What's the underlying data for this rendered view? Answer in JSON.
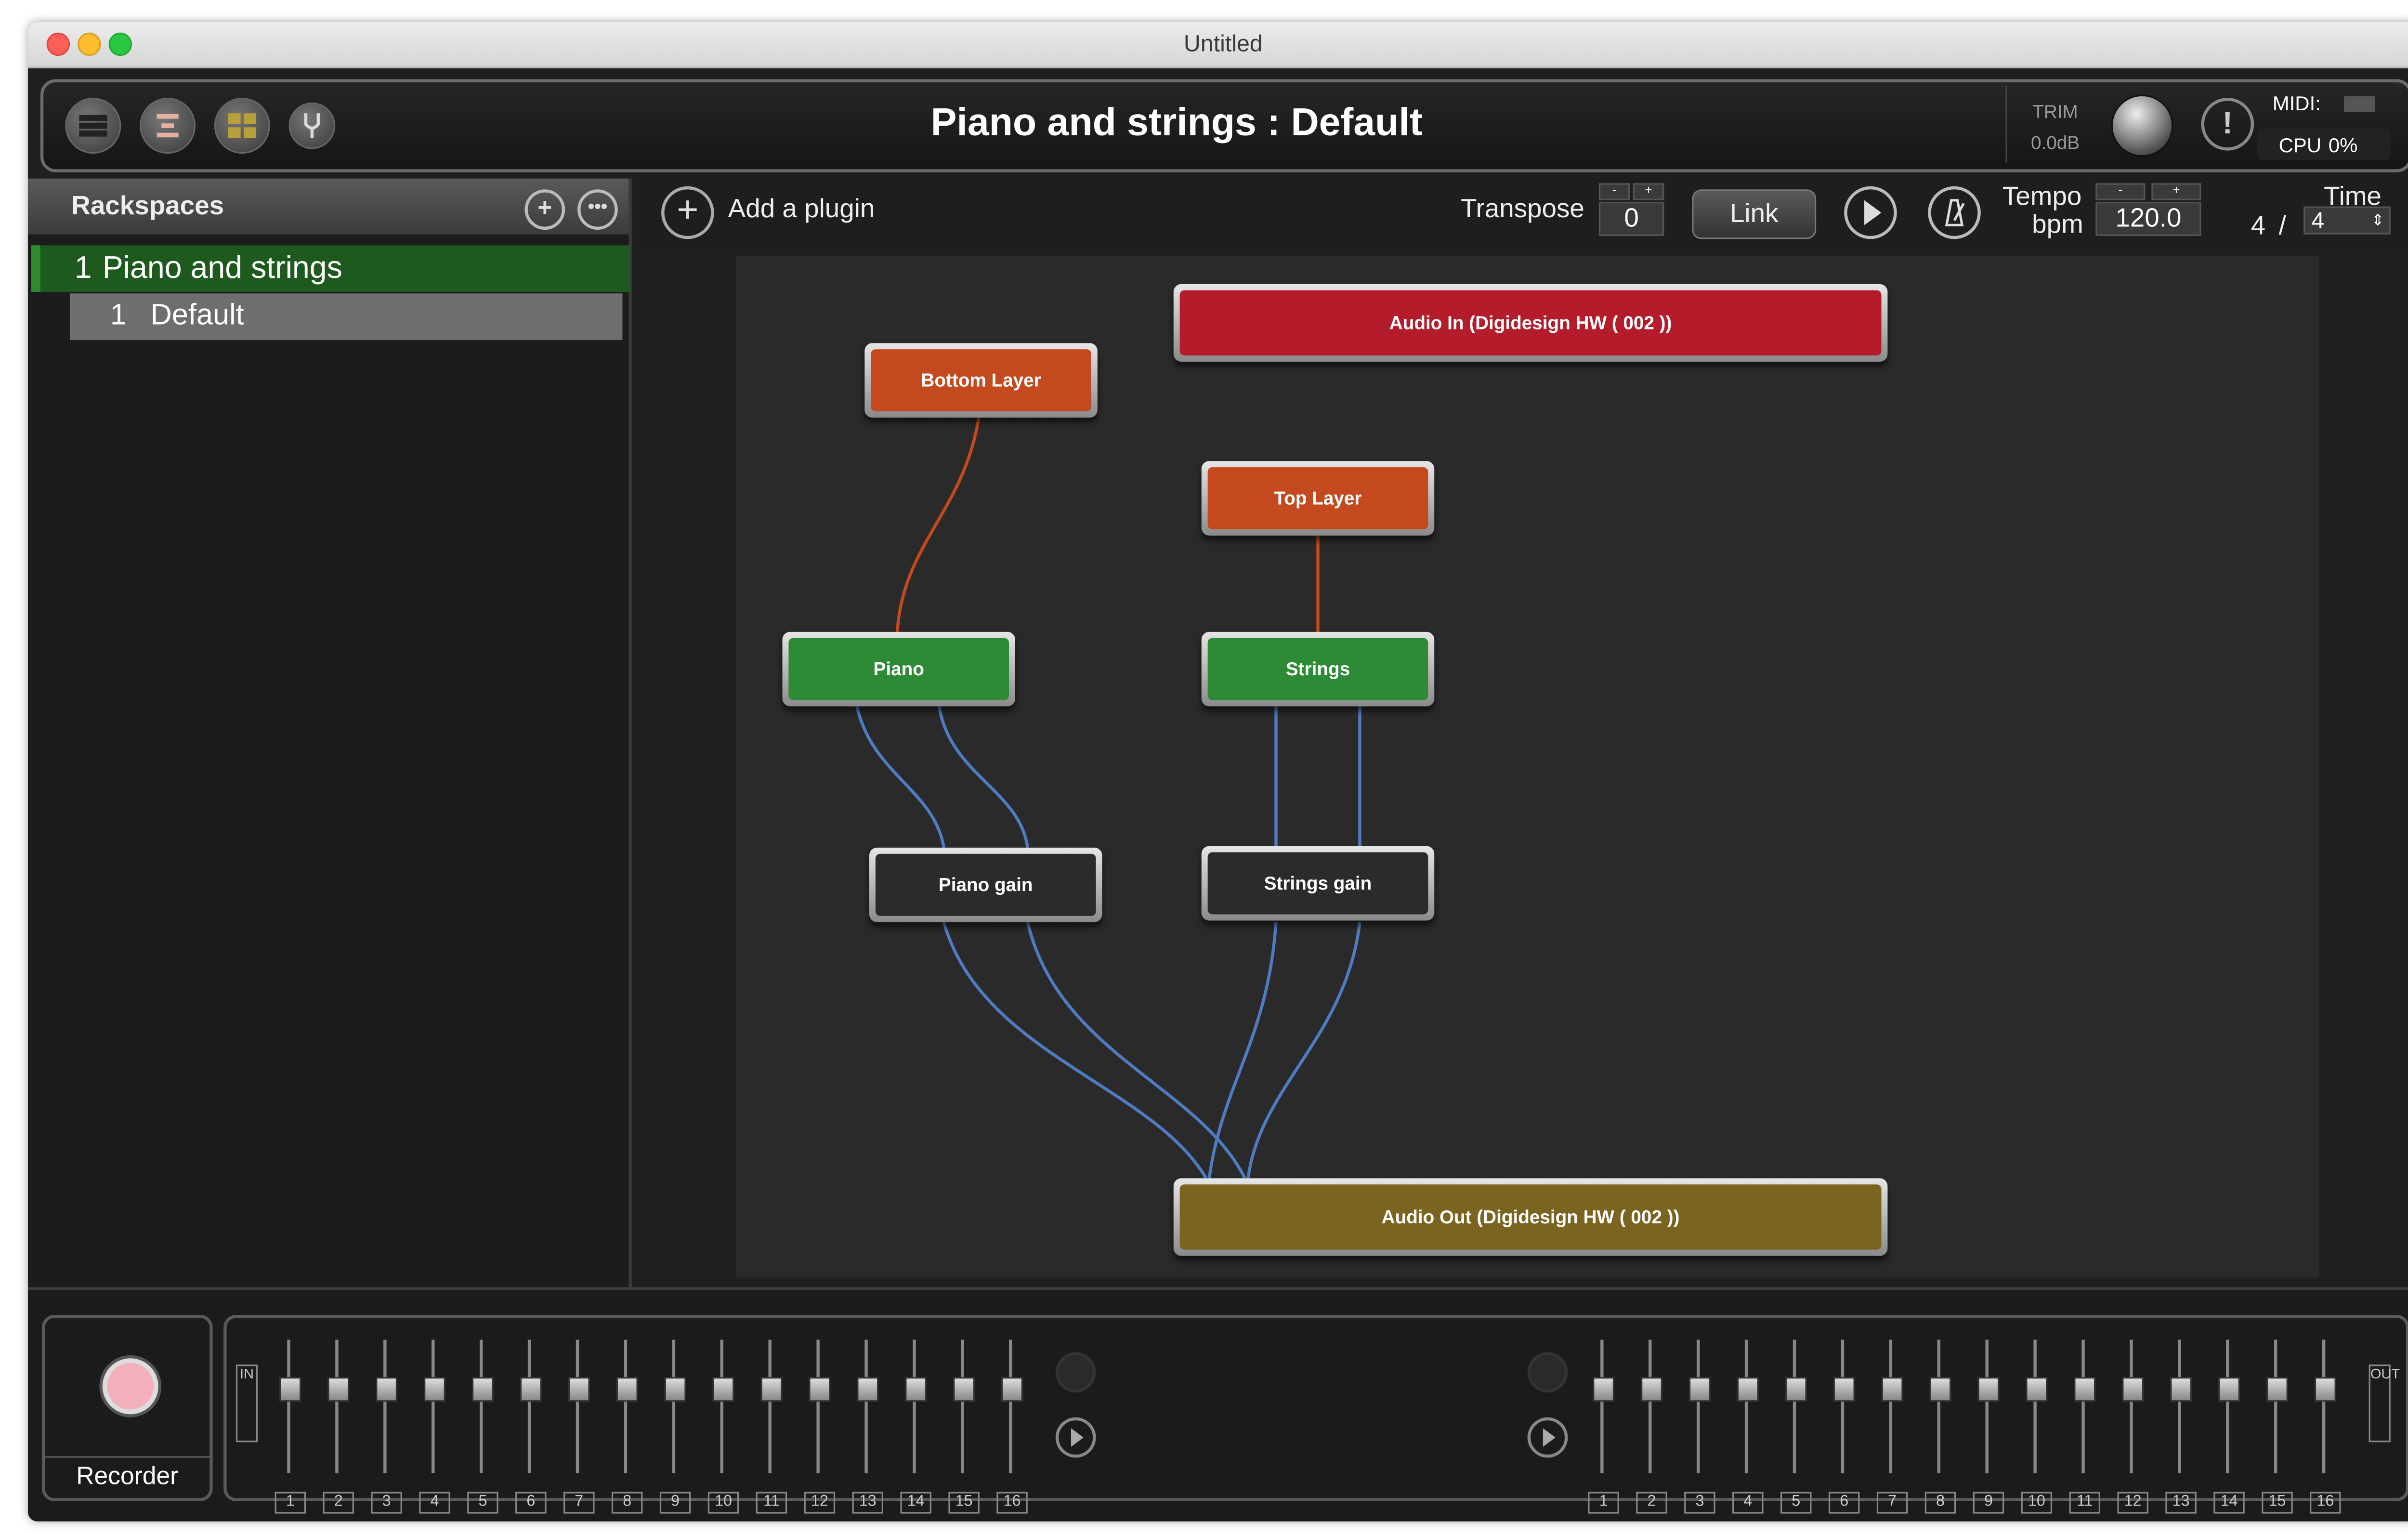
{
  "window_title": "Untitled",
  "header": {
    "title": "Piano and strings : Default",
    "trim_label": "TRIM",
    "trim_value": "0.0dB",
    "midi_label": "MIDI:",
    "cpu_label": "CPU",
    "cpu_value": "0%"
  },
  "sidebar": {
    "title": "Rackspaces",
    "rackspaces": [
      {
        "number": "1",
        "name": "Piano and strings"
      }
    ],
    "variations": [
      {
        "number": "1",
        "name": "Default"
      }
    ]
  },
  "toolbar": {
    "add_plugin": "Add a plugin",
    "transpose_label": "Transpose",
    "transpose_value": "0",
    "link_label": "Link",
    "tempo_label": "Tempo",
    "bpm_label": "bpm",
    "tempo_value": "120.0",
    "time_label": "Time",
    "time_numerator": "4",
    "time_separator": "/",
    "time_denominator": "4"
  },
  "nodes": {
    "audio_in": "Audio In (Digidesign HW ( 002 ))",
    "bottom_layer": "Bottom Layer",
    "top_layer": "Top Layer",
    "piano": "Piano",
    "strings": "Strings",
    "piano_gain": "Piano gain",
    "strings_gain": "Strings gain",
    "audio_out": "Audio Out (Digidesign HW ( 002 ))"
  },
  "colors": {
    "audio_in": "#b41c2c",
    "layer": "#c4491f",
    "instrument": "#2d8a35",
    "gain": "#2b2b2b",
    "audio_out": "#7a6420",
    "audio_wire": "#4f7cc0",
    "midi_wire": "#c4491f"
  },
  "bottom": {
    "recorder_label": "Recorder",
    "in_tag": "IN",
    "out_tag": "OUT",
    "channels": [
      "1",
      "2",
      "3",
      "4",
      "5",
      "6",
      "7",
      "8",
      "9",
      "10",
      "11",
      "12",
      "13",
      "14",
      "15",
      "16"
    ]
  }
}
